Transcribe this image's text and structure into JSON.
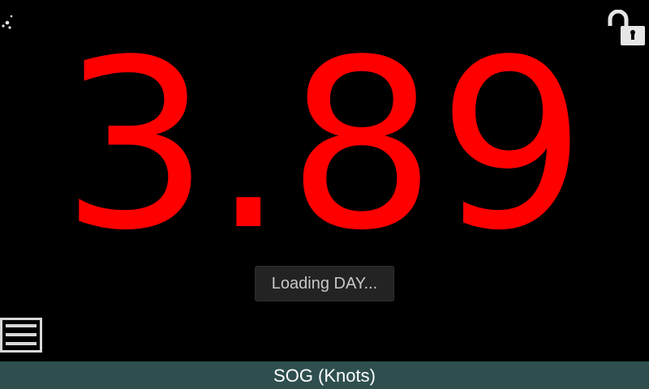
{
  "app": {
    "reading_value": "3.89",
    "reading_label": "SOG (Knots)",
    "toast_message": "Loading DAY...",
    "value_color": "#ff0000",
    "label_bar_color": "#2f4f4f"
  },
  "icons": {
    "night_mode": "moon-stars-icon",
    "lock": "unlocked-padlock-icon",
    "menu": "hamburger-menu-icon"
  }
}
